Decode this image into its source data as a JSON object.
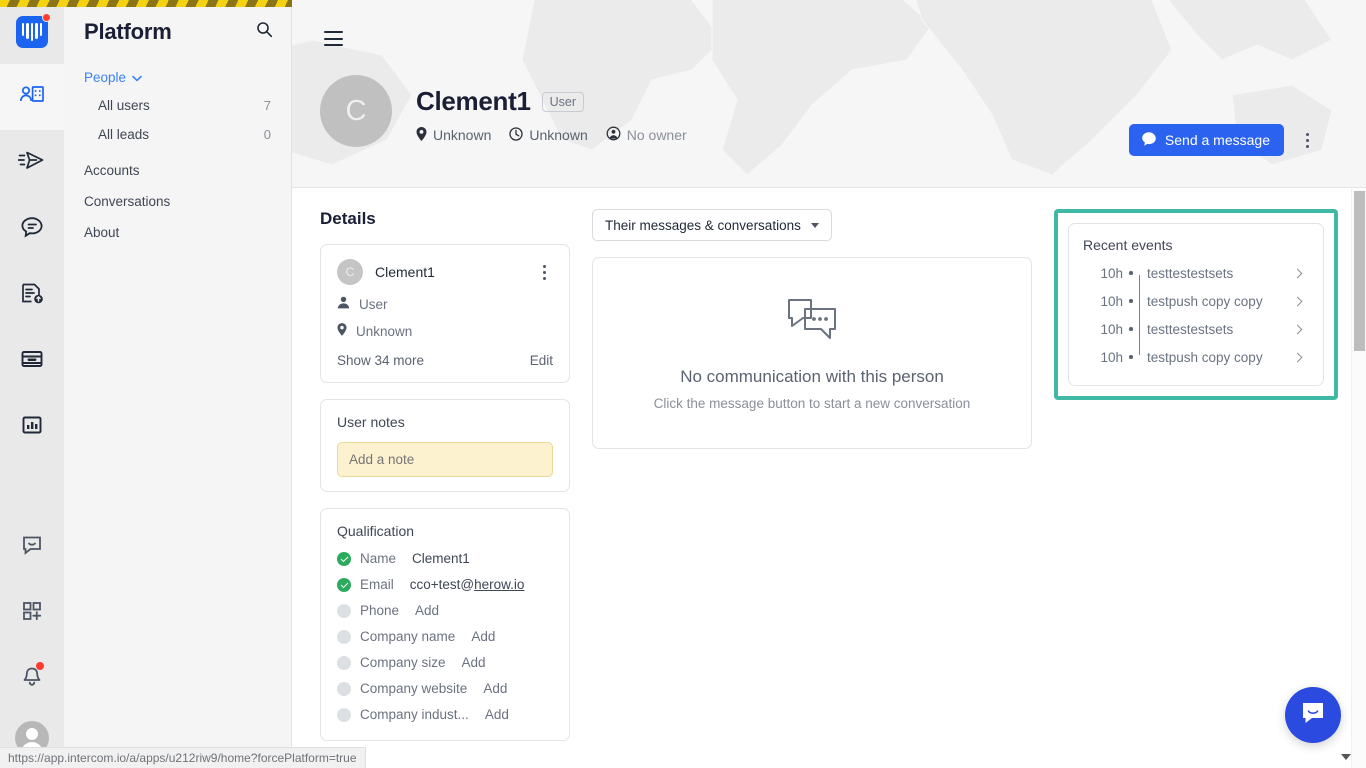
{
  "rail": {
    "logo_name": "intercom-logo",
    "items": [
      {
        "name": "contacts-icon",
        "label": "Contacts",
        "active": true
      },
      {
        "name": "outbound-icon",
        "label": "Outbound",
        "active": false
      },
      {
        "name": "inbox-chat-icon",
        "label": "Messages",
        "active": false
      },
      {
        "name": "articles-upload-icon",
        "label": "Articles",
        "active": false
      },
      {
        "name": "product-tours-icon",
        "label": "Product Tours",
        "active": false
      },
      {
        "name": "reports-icon",
        "label": "Reports",
        "active": false
      }
    ],
    "bottom_items": [
      {
        "name": "messenger-icon",
        "label": "Messenger"
      },
      {
        "name": "apps-grid-add-icon",
        "label": "Apps"
      },
      {
        "name": "bell-icon",
        "label": "Notifications",
        "badge": true
      }
    ]
  },
  "nav": {
    "title": "Platform",
    "search_icon": "search-icon",
    "section": {
      "label": "People",
      "chevron": "chevron-down-icon"
    },
    "subitems": [
      {
        "label": "All users",
        "count": "7"
      },
      {
        "label": "All leads",
        "count": "0"
      }
    ],
    "links": [
      "Accounts",
      "Conversations",
      "About"
    ]
  },
  "header": {
    "menu_icon": "hamburger-icon",
    "avatar_initial": "C",
    "name": "Clement1",
    "tag": "User",
    "meta": [
      {
        "icon": "location-pin-icon",
        "text": "Unknown"
      },
      {
        "icon": "clock-icon",
        "text": "Unknown"
      },
      {
        "icon": "owner-globe-icon",
        "text": "No owner"
      }
    ],
    "primary_button": {
      "label": "Send a message",
      "icon": "chat-bubble-icon"
    },
    "overflow_icon": "kebab-menu-icon"
  },
  "details": {
    "title": "Details",
    "identity": {
      "avatar_initial": "C",
      "name": "Clement1",
      "menu_icon": "kebab-menu-icon",
      "attributes": [
        {
          "icon": "person-icon",
          "text": "User"
        },
        {
          "icon": "location-pin-icon",
          "text": "Unknown"
        }
      ],
      "show_more": "Show 34 more",
      "edit": "Edit"
    },
    "notes": {
      "heading": "User notes",
      "placeholder": "Add a note"
    },
    "qualification": {
      "heading": "Qualification",
      "rows": [
        {
          "complete": true,
          "label": "Name",
          "value": "Clement1",
          "link": false
        },
        {
          "complete": true,
          "label": "Email",
          "value": "cco+test@herow.io",
          "link": true,
          "link_plain": "cco+test@",
          "link_under": "herow.io"
        },
        {
          "complete": false,
          "label": "Phone",
          "value": "Add"
        },
        {
          "complete": false,
          "label": "Company name",
          "value": "Add"
        },
        {
          "complete": false,
          "label": "Company size",
          "value": "Add"
        },
        {
          "complete": false,
          "label": "Company website",
          "value": "Add"
        },
        {
          "complete": false,
          "label": "Company indust...",
          "value": "Add"
        }
      ]
    }
  },
  "conversations": {
    "filter_label": "Their messages & conversations",
    "empty_icon": "conversation-bubbles-icon",
    "empty_title": "No communication with this person",
    "empty_subtitle": "Click the message button to start a new conversation"
  },
  "recent_events": {
    "heading": "Recent events",
    "highlight_color": "#3fb9a4",
    "events": [
      {
        "time": "10h",
        "name": "testtestestsets"
      },
      {
        "time": "10h",
        "name": "testpush copy copy"
      },
      {
        "time": "10h",
        "name": "testtestestsets"
      },
      {
        "time": "10h",
        "name": "testpush copy copy"
      }
    ]
  },
  "launcher": {
    "icon": "messenger-launcher-icon",
    "color": "#2b4ae0"
  },
  "statusbar": {
    "url": "https://app.intercom.io/a/apps/u212riw9/home?forcePlatform=true"
  }
}
